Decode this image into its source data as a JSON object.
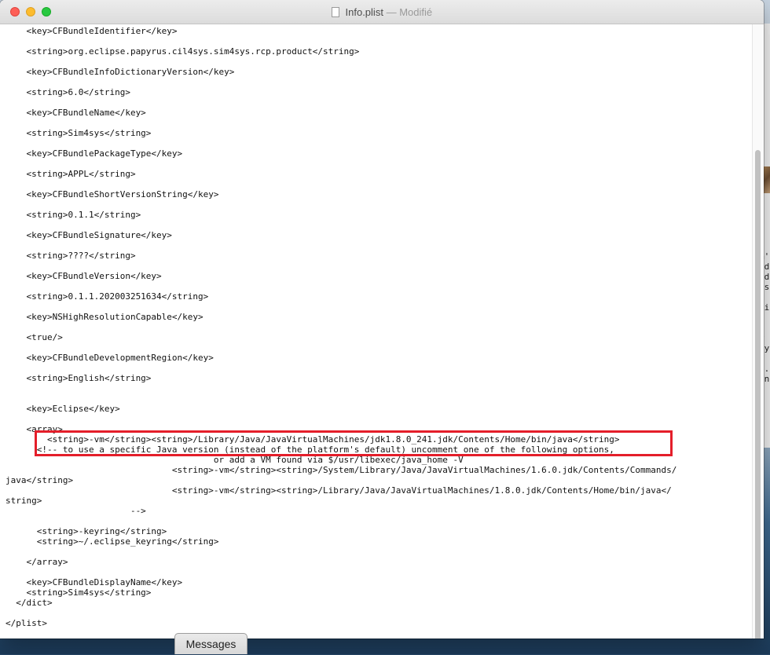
{
  "window": {
    "filename": "Info.plist",
    "separator": "—",
    "status": "Modifié"
  },
  "editor": {
    "content": "    <key>CFBundleIdentifier</key>\n\n    <string>org.eclipse.papyrus.cil4sys.sim4sys.rcp.product</string>\n\n    <key>CFBundleInfoDictionaryVersion</key>\n\n    <string>6.0</string>\n\n    <key>CFBundleName</key>\n\n    <string>Sim4sys</string>\n\n    <key>CFBundlePackageType</key>\n\n    <string>APPL</string>\n\n    <key>CFBundleShortVersionString</key>\n\n    <string>0.1.1</string>\n\n    <key>CFBundleSignature</key>\n\n    <string>????</string>\n\n    <key>CFBundleVersion</key>\n\n    <string>0.1.1.202003251634</string>\n\n    <key>NSHighResolutionCapable</key>\n\n    <true/>\n\n    <key>CFBundleDevelopmentRegion</key>\n\n    <string>English</string>\n\n\n    <key>Eclipse</key>\n\n    <array>\n        <string>-vm</string><string>/Library/Java/JavaVirtualMachines/jdk1.8.0_241.jdk/Contents/Home/bin/java</string>\n      <!-- to use a specific Java version (instead of the platform's default) uncomment one of the following options,\n                                        or add a VM found via $/usr/libexec/java_home -V\n                                <string>-vm</string><string>/System/Library/Java/JavaVirtualMachines/1.6.0.jdk/Contents/Commands/\njava</string>\n                                <string>-vm</string><string>/Library/Java/JavaVirtualMachines/1.8.0.jdk/Contents/Home/bin/java</\nstring>\n                        -->\n\n      <string>-keyring</string>\n      <string>~/.eclipse_keyring</string>\n\n    </array>\n\n    <key>CFBundleDisplayName</key>\n    <string>Sim4sys</string>\n  </dict>\n\n</plist>"
  },
  "bottom_tab": {
    "label": "Messages"
  },
  "background": {
    "side_text": "m'\nod\nnd\nis\n\ndi\n\n\ny\ney\n\n .\nin"
  },
  "colors": {
    "highlight": "#e41e2a",
    "titlebar": "#e3e3e3"
  }
}
